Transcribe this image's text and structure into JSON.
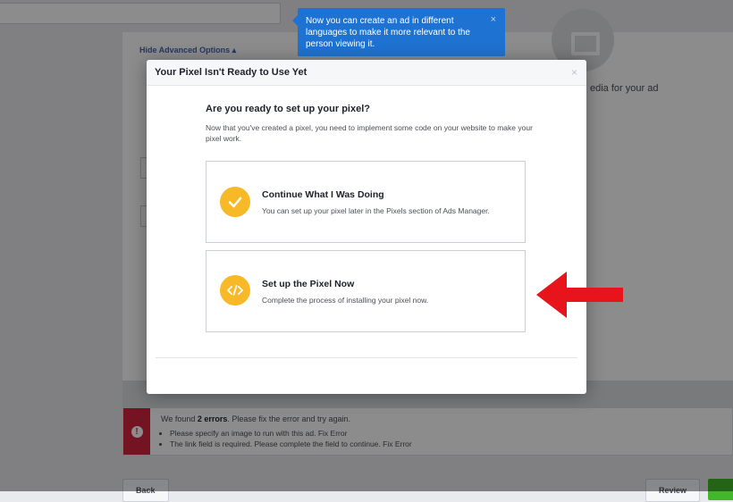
{
  "background": {
    "advanced_options": "Hide Advanced Options ▴",
    "media_hint": "edia for your ad",
    "error": {
      "title_prefix": "We found ",
      "title_count": "2 errors",
      "title_suffix": ". Please fix the error and try again.",
      "items": [
        "Please specify an image to run with this ad. Fix Error",
        "The link field is required. Please complete the field to continue. Fix Error"
      ]
    },
    "back_label": "Back",
    "review_label": "Review"
  },
  "tooltip": {
    "text": "Now you can create an ad in different languages to make it more relevant to the person viewing it.",
    "close": "×"
  },
  "dialog": {
    "title": "Your Pixel Isn't Ready to Use Yet",
    "close": "×",
    "question": "Are you ready to set up your pixel?",
    "description": "Now that you've created a pixel, you need to implement some code on your website to make your pixel work.",
    "options": [
      {
        "icon": "checkmark-icon",
        "title": "Continue What I Was Doing",
        "description": "You can set up your pixel later in the Pixels section of Ads Manager."
      },
      {
        "icon": "code-icon",
        "title": "Set up the Pixel Now",
        "description": "Complete the process of installing your pixel now."
      }
    ]
  },
  "annotation": {
    "arrow_color": "#e8141b"
  }
}
